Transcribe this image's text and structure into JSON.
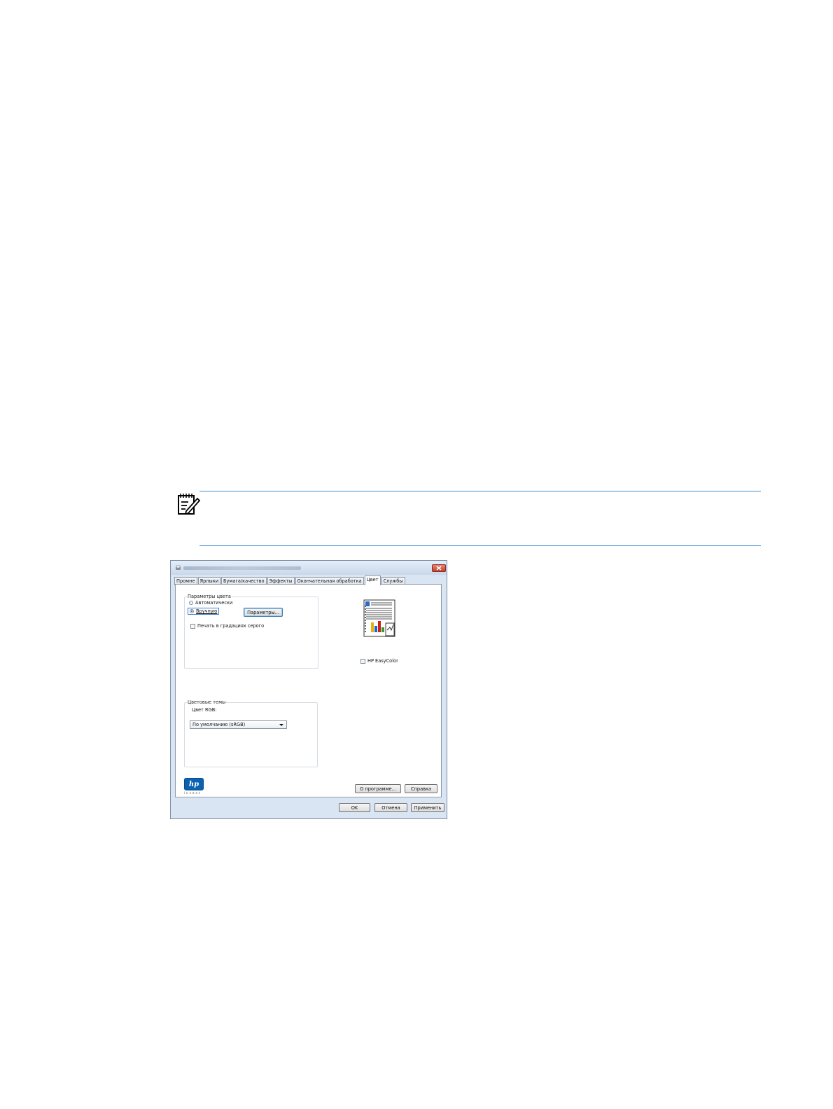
{
  "dialog": {
    "tabs": [
      {
        "label": "Промне",
        "active": false
      },
      {
        "label": "Ярлыки",
        "active": false
      },
      {
        "label": "Бумага/качество",
        "active": false
      },
      {
        "label": "Эффекты",
        "active": false
      },
      {
        "label": "Окончательная обработка",
        "active": false
      },
      {
        "label": "Цвет",
        "active": true
      },
      {
        "label": "Службы",
        "active": false
      }
    ],
    "color_options": {
      "group_label": "Параметры цвета",
      "radio_auto": "Автоматически",
      "radio_manual": "Вручную",
      "settings_button": "Параметры...",
      "grayscale_checkbox": "Печать в градациях серого"
    },
    "easycolor_checkbox": "HP EasyColor",
    "color_themes": {
      "group_label": "Цветовые темы",
      "rgb_label": "Цвет RGB:",
      "rgb_value": "По умолчанию (sRGB)"
    },
    "about_button": "О программе...",
    "help_button": "Справка",
    "ok_button": "OK",
    "cancel_button": "Отмена",
    "apply_button": "Применить",
    "logo_tagline": "invent"
  },
  "colors": {
    "note_rule": "#3f8fd0",
    "hp_blue": "#0a62b0",
    "close_red": "#c4402c"
  }
}
